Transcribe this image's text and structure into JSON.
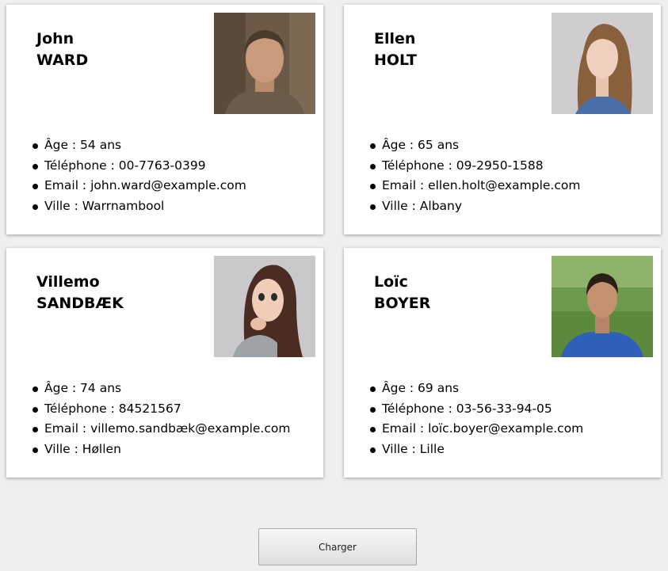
{
  "people": [
    {
      "first_name": "John",
      "last_name": "WARD",
      "age": "Âge : 54 ans",
      "phone": "Téléphone : 00-7763-0399",
      "email": "Email : john.ward@example.com",
      "city": "Ville : Warrnambool"
    },
    {
      "first_name": "Ellen",
      "last_name": "HOLT",
      "age": "Âge : 65 ans",
      "phone": "Téléphone : 09-2950-1588",
      "email": "Email : ellen.holt@example.com",
      "city": "Ville : Albany"
    },
    {
      "first_name": "Villemo",
      "last_name": "SANDBÆK",
      "age": "Âge : 74 ans",
      "phone": "Téléphone : 84521567",
      "email": "Email : villemo.sandbæk@example.com",
      "city": "Ville : Høllen"
    },
    {
      "first_name": "Loïc",
      "last_name": "BOYER",
      "age": "Âge : 69 ans",
      "phone": "Téléphone : 03-56-33-94-05",
      "email": "Email : loïc.boyer@example.com",
      "city": "Ville : Lille"
    }
  ],
  "load_button": "Charger"
}
